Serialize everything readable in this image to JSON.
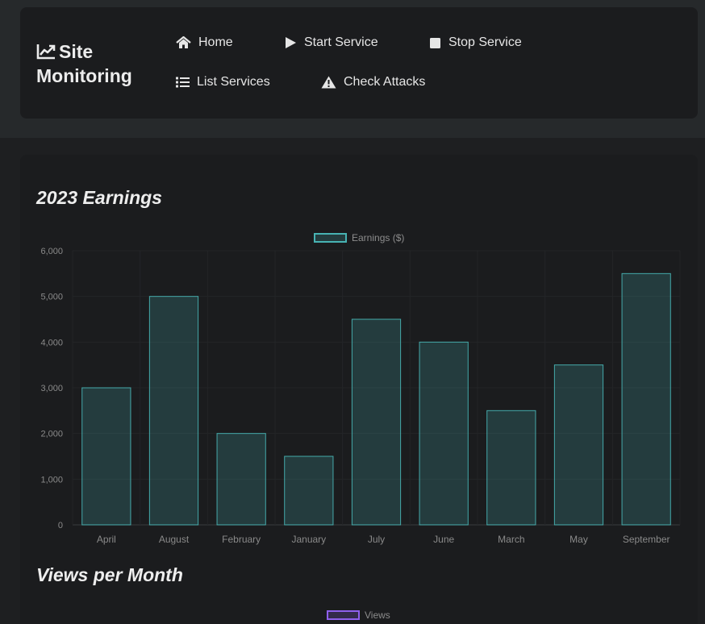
{
  "navbar": {
    "brand_line1": "Site",
    "brand_line2": "Monitoring",
    "brand_icon": "chart-line-icon",
    "items": [
      {
        "label": "Home",
        "icon": "home-icon"
      },
      {
        "label": "Start Service",
        "icon": "play-icon"
      },
      {
        "label": "Stop Service",
        "icon": "stop-icon"
      },
      {
        "label": "List Services",
        "icon": "list-icon"
      },
      {
        "label": "Check Attacks",
        "icon": "warning-icon"
      }
    ]
  },
  "sections": {
    "earnings_title": "2023 Earnings",
    "views_title": "Views per Month"
  },
  "colors": {
    "accent_teal": "#4bc0c0",
    "accent_purple": "#9966ff"
  },
  "chart_data": [
    {
      "type": "bar",
      "title": "2023 Earnings",
      "categories": [
        "April",
        "August",
        "February",
        "January",
        "July",
        "June",
        "March",
        "May",
        "September"
      ],
      "series": [
        {
          "name": "Earnings ($)",
          "values": [
            3000,
            5000,
            2000,
            1500,
            4500,
            4000,
            2500,
            3500,
            5500
          ]
        }
      ],
      "yticks": [
        "0",
        "1,000",
        "2,000",
        "3,000",
        "4,000",
        "5,000",
        "6,000"
      ],
      "ylim": [
        0,
        6000
      ],
      "grid": true,
      "legend": "top-center"
    },
    {
      "type": "bar",
      "title": "Views per Month",
      "series": [
        {
          "name": "Views",
          "values": []
        }
      ],
      "legend": "top-center"
    }
  ]
}
